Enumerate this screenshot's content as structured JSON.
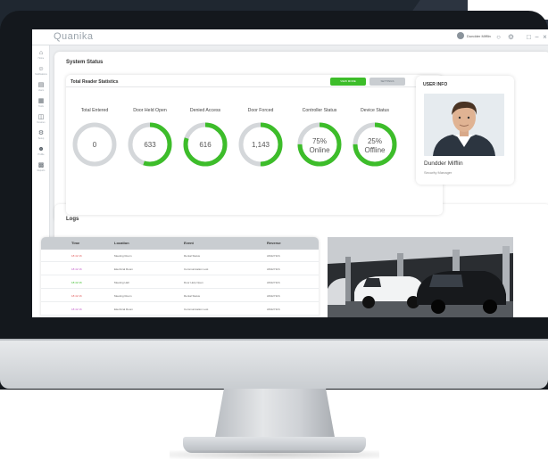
{
  "app": {
    "logo_text": "Quanika",
    "user_name": "Dundder Mifflin"
  },
  "sidebar": {
    "items": [
      {
        "label": "Home",
        "icon": "home-icon"
      },
      {
        "label": "Notifications",
        "icon": "people-icon"
      },
      {
        "label": "Users",
        "icon": "document-icon"
      },
      {
        "label": "Tools",
        "icon": "grid-icon"
      },
      {
        "label": "Devices",
        "icon": "devices-icon"
      },
      {
        "label": "Setup",
        "icon": "settings-icon"
      },
      {
        "label": "Profile",
        "icon": "user-icon"
      },
      {
        "label": "Reports",
        "icon": "report-icon"
      }
    ]
  },
  "system_status": {
    "title": "System Status",
    "panel_title": "Total Reader Statistics",
    "view_more_label": "VIEW MORE",
    "settings_label": "SETTINGS",
    "stats": [
      {
        "label": "Total Entered",
        "value": "0",
        "fill": 0
      },
      {
        "label": "Door Held Open",
        "value": "633",
        "fill": 0.55
      },
      {
        "label": "Denied Access",
        "value": "616",
        "fill": 0.8
      },
      {
        "label": "Door Forced",
        "value": "1,143",
        "fill": 0.5
      },
      {
        "label": "Controller Status",
        "value_line1": "75%",
        "value_line2": "Online",
        "fill": 0.75
      },
      {
        "label": "Device Status",
        "value_line1": "25%",
        "value_line2": "Offline",
        "fill": 0.75
      }
    ],
    "colors": {
      "ring_fill": "#3dbd2a",
      "ring_track": "#d4d7da"
    }
  },
  "user_info": {
    "title": "USER INFO",
    "name": "Dundder Mifflin",
    "role": "Security Manager"
  },
  "logs": {
    "title": "Logs",
    "columns": [
      "Time",
      "Location",
      "Event",
      "Reverse"
    ],
    "rows": [
      {
        "time": "18:42:16",
        "location": "Meeting Room",
        "event": "Rental Status",
        "reverse": "AM12711S",
        "color": "#e05a5a"
      },
      {
        "time": "18:42:16",
        "location": "Electrical Room",
        "event": "Communication Lost",
        "reverse": "AM12711S",
        "color": "#c05ac8"
      },
      {
        "time": "18:42:16",
        "location": "Meeting Hall",
        "event": "Door Help Open",
        "reverse": "AM12711S",
        "color": "#3dbd2a"
      },
      {
        "time": "18:42:16",
        "location": "Meeting Room",
        "event": "Rental Status",
        "reverse": "AM12711S",
        "color": "#e05a5a"
      },
      {
        "time": "18:42:16",
        "location": "Electrical Room",
        "event": "Communication Lost",
        "reverse": "AM12711S",
        "color": "#c05ac8"
      }
    ]
  }
}
